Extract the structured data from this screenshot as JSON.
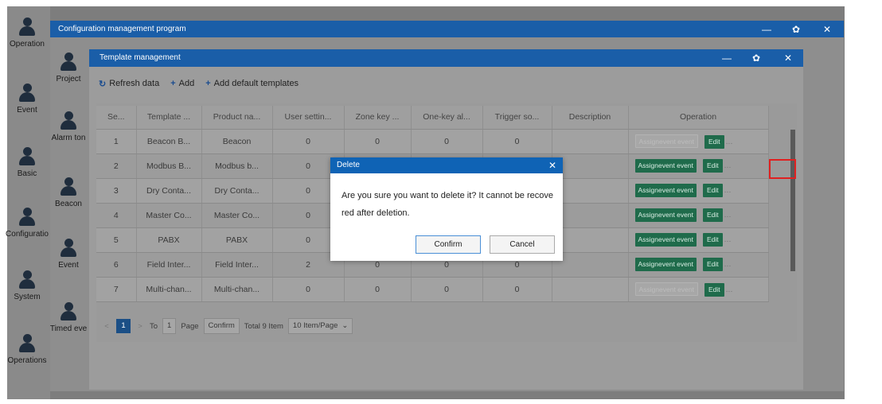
{
  "outer_window": {
    "title": "Configuration management program",
    "controls": [
      "—",
      "✿",
      "✕"
    ]
  },
  "outer_sidebar": [
    {
      "label": "Operation"
    },
    {
      "label": "Event"
    },
    {
      "label": "Basic"
    },
    {
      "label": "Configuratio"
    },
    {
      "label": "System"
    },
    {
      "label": "Operations"
    }
  ],
  "inner_sidebar": [
    {
      "label": "Project"
    },
    {
      "label": "Alarm ton"
    },
    {
      "label": "Beacon"
    },
    {
      "label": "Event"
    },
    {
      "label": "Timed eve"
    }
  ],
  "template_window": {
    "title": "Template management",
    "controls": [
      "—",
      "✿",
      "✕"
    ]
  },
  "toolbar": {
    "refresh_icon": "↻",
    "refresh_label": "Refresh data",
    "add_icon": "+",
    "add_label": "Add",
    "add_default_icon": "+",
    "add_default_label": "Add default templates"
  },
  "table": {
    "headers": [
      "Se...",
      "Template ...",
      "Product na...",
      "User settin...",
      "Zone key ...",
      "One-key al...",
      "Trigger so...",
      "Description",
      "Operation"
    ],
    "rows": [
      {
        "seq": "1",
        "template": "Beacon B...",
        "product": "Beacon",
        "user": "0",
        "zone": "0",
        "onekey": "0",
        "trigger": "0",
        "desc": "",
        "assign_disabled": true
      },
      {
        "seq": "2",
        "template": "Modbus B...",
        "product": "Modbus b...",
        "user": "0",
        "zone": "",
        "onekey": "",
        "trigger": "",
        "desc": "",
        "assign_disabled": false
      },
      {
        "seq": "3",
        "template": "Dry Conta...",
        "product": "Dry Conta...",
        "user": "0",
        "zone": "",
        "onekey": "",
        "trigger": "",
        "desc": "",
        "assign_disabled": false
      },
      {
        "seq": "4",
        "template": "Master Co...",
        "product": "Master Co...",
        "user": "0",
        "zone": "",
        "onekey": "",
        "trigger": "",
        "desc": "",
        "assign_disabled": false
      },
      {
        "seq": "5",
        "template": "PABX",
        "product": "PABX",
        "user": "0",
        "zone": "",
        "onekey": "",
        "trigger": "",
        "desc": "",
        "assign_disabled": false
      },
      {
        "seq": "6",
        "template": "Field Inter...",
        "product": "Field Inter...",
        "user": "2",
        "zone": "0",
        "onekey": "0",
        "trigger": "0",
        "desc": "",
        "assign_disabled": false
      },
      {
        "seq": "7",
        "template": "Multi-chan...",
        "product": "Multi-chan...",
        "user": "0",
        "zone": "0",
        "onekey": "0",
        "trigger": "0",
        "desc": "",
        "assign_disabled": true
      }
    ],
    "assign_label": "Assignevent event",
    "edit_label": "Edit",
    "more_label": "..."
  },
  "pagination": {
    "prev": "<",
    "current_page": "1",
    "next": ">",
    "to_label": "To",
    "page_input": "1",
    "page_label": "Page",
    "confirm_label": "Confirm",
    "total_label": "Total 9 Item",
    "page_size": "10 Item/Page",
    "page_size_icon": "⌄"
  },
  "dialog": {
    "title": "Delete",
    "close": "✕",
    "message": "Are you sure you want to delete it? It cannot be recovered after deletion.",
    "confirm_label": "Confirm",
    "cancel_label": "Cancel"
  }
}
